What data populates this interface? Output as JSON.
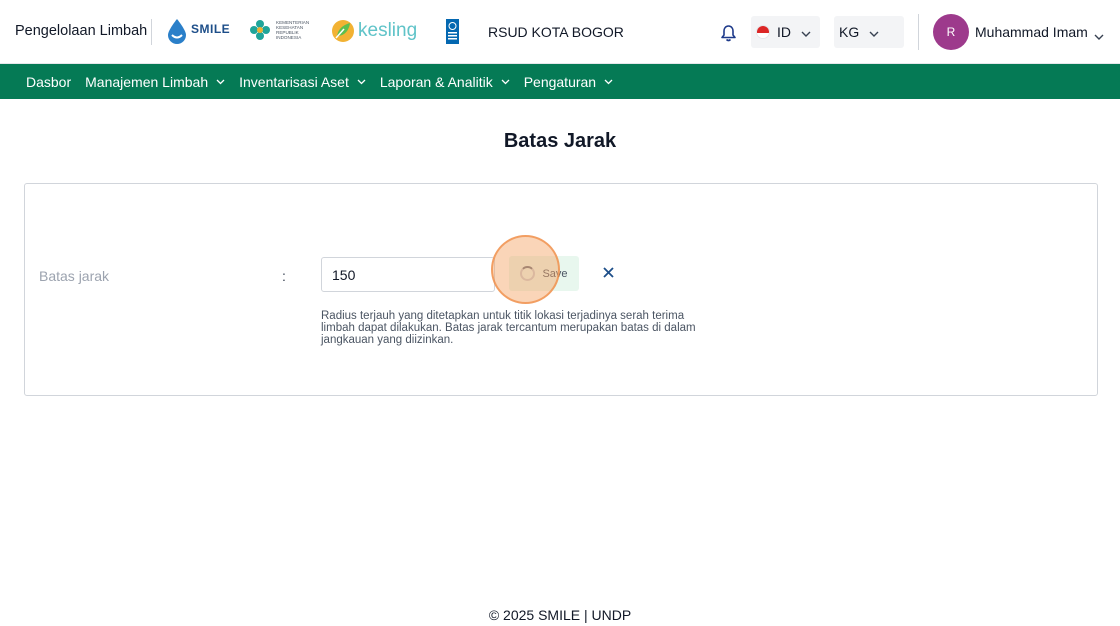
{
  "header": {
    "app_title": "Pengelolaan Limbah",
    "logos": {
      "smile": "SMILE",
      "kemkes": "KEMENTERIAN KESEHATAN REPUBLIK INDONESIA",
      "kesling": "kesling"
    },
    "hospital": "RSUD KOTA BOGOR",
    "language": "ID",
    "unit": "KG",
    "avatar_initial": "R",
    "user_name": "Muhammad Imam"
  },
  "nav": {
    "items": [
      {
        "label": "Dasbor"
      },
      {
        "label": "Manajemen Limbah"
      },
      {
        "label": "Inventarisasi Aset"
      },
      {
        "label": "Laporan & Analitik"
      },
      {
        "label": "Pengaturan"
      }
    ]
  },
  "main": {
    "title": "Batas Jarak",
    "field_label": "Batas jarak",
    "colon": ":",
    "input_value": "150",
    "save_label": "Save",
    "help_text": "Radius terjauh yang ditetapkan untuk titik lokasi terjadinya serah terima limbah dapat dilakukan. Batas jarak tercantum merupakan batas di dalam jangkauan yang diizinkan."
  },
  "footer": {
    "text": "© 2025 SMILE | UNDP"
  },
  "colors": {
    "brand_green": "#057a55",
    "avatar": "#9d3a8c",
    "save_bg": "#e8f7ee",
    "cancel": "#1d4e89"
  }
}
